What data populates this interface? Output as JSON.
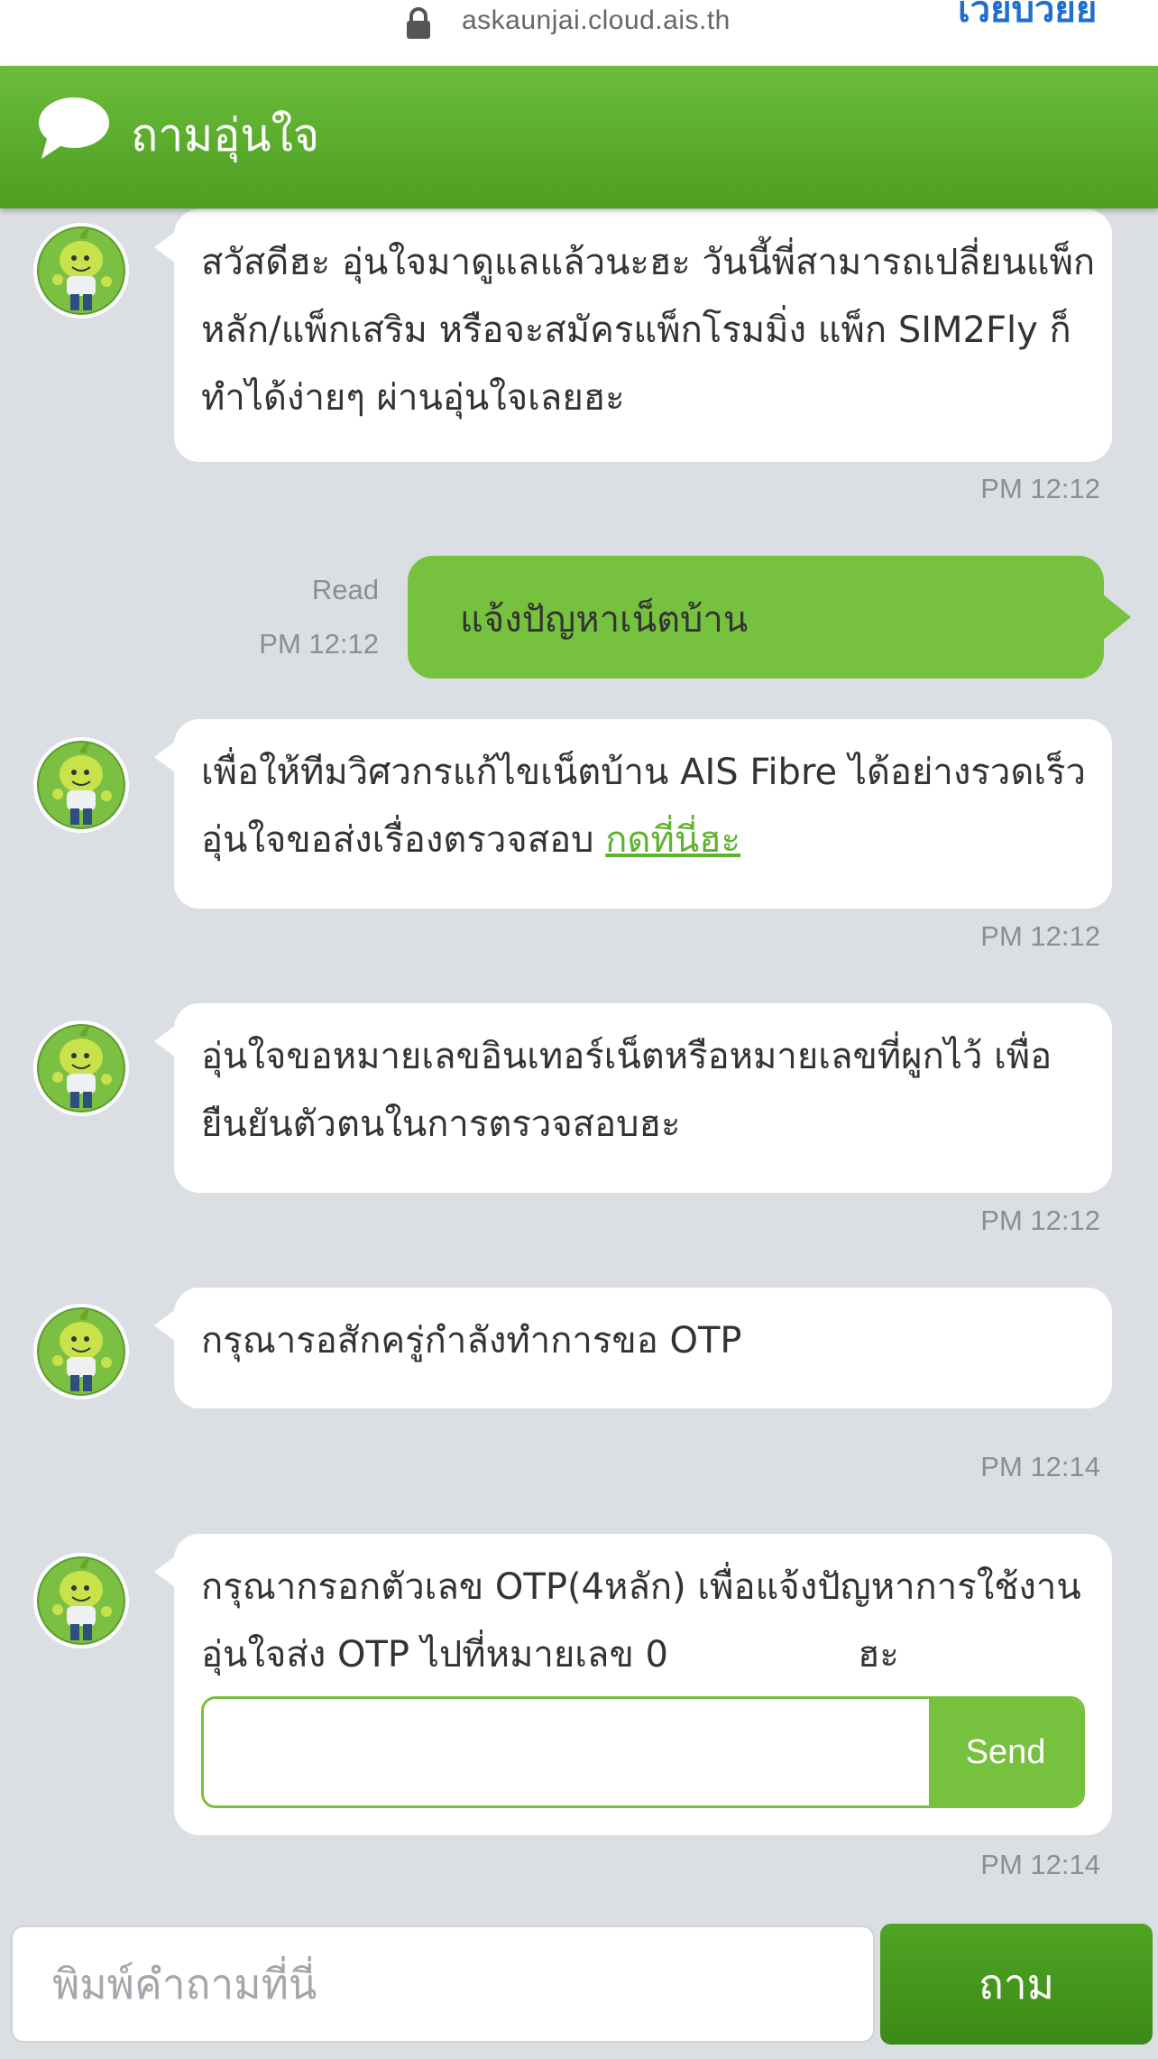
{
  "browser": {
    "url": "askaunjai.cloud.ais.th",
    "corner_link": "เวยบวยย"
  },
  "header": {
    "title": "ถามอุ่นใจ"
  },
  "messages": [
    {
      "lines": [
        "สวัสดีฮะ อุ่นใจมาดูแลแล้วนะฮะ วันนี้พี่สามารถเปลี่ยนแพ็ก",
        "หลัก/แพ็กเสริม หรือจะสมัครแพ็กโรมมิ่ง แพ็ก SIM2Fly ก็",
        "ทำได้ง่ายๆ ผ่านอุ่นใจเลยฮะ"
      ],
      "time": "PM 12:12"
    },
    {
      "text": "เพื่อให้ทีมวิศวกรแก้ไขเน็ตบ้าน AIS Fibre ได้อย่างรวดเร็ว",
      "line2_prefix": "อุ่นใจขอส่งเรื่องตรวจสอบ ",
      "link": "กดที่นี่ฮะ",
      "time": "PM 12:12"
    },
    {
      "lines": [
        "อุ่นใจขอหมายเลขอินเทอร์เน็ตหรือหมายเลขที่ผูกไว้ เพื่อ",
        "ยืนยันตัวตนในการตรวจสอบฮะ"
      ],
      "time": "PM 12:12"
    },
    {
      "lines": [
        "กรุณารอสักครู่กำลังทำการขอ OTP"
      ],
      "time": "PM 12:14"
    },
    {
      "lines": [
        "กรุณากรอกตัวเลข OTP(4หลัก) เพื่อแจ้งปัญหาการใช้งาน",
        "อุ่นใจส่ง OTP ไปที่หมายเลข 0",
        "ฮะ"
      ],
      "otp_value": "",
      "send_label": "Send",
      "time": "PM 12:14"
    }
  ],
  "user_message": {
    "text": "แจ้งปัญหาเน็ตบ้าน",
    "status": "Read",
    "time": "PM 12:12"
  },
  "composer": {
    "placeholder": "พิมพ์คำถามที่นี่",
    "value": "",
    "button_label": "ถาม"
  },
  "colors": {
    "brand_green": "#76c13d",
    "header_green": "#5aaa2c",
    "background": "#dbdfe4",
    "link_green": "#5db32e"
  }
}
